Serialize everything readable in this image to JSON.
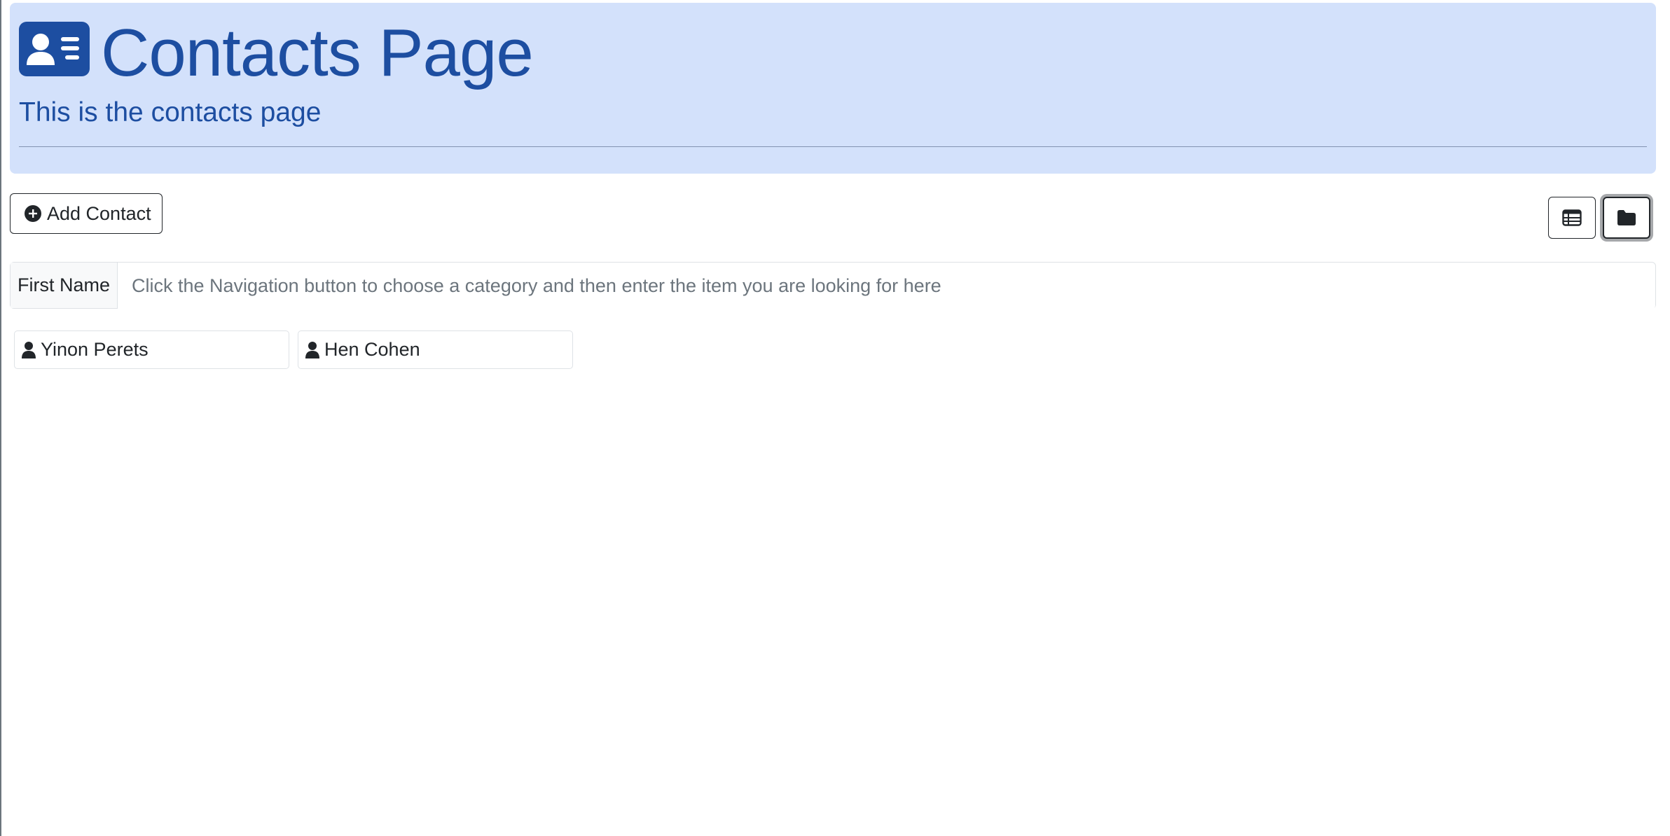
{
  "header": {
    "logo_icon": "person-vcard-icon",
    "title": "Contacts Page",
    "subtitle": "This is the contacts page",
    "background_color": "#d3e1fb",
    "accent_color": "#1d4ea1"
  },
  "toolbar": {
    "add_label": "Add Contact",
    "add_icon": "plus-circle-icon",
    "view_buttons": [
      {
        "icon": "table-icon",
        "active": false
      },
      {
        "icon": "folder-icon",
        "active": true
      }
    ]
  },
  "search": {
    "category_label": "First Name",
    "placeholder": "Click the Navigation button to choose a category and then enter the item you are looking for here",
    "value": ""
  },
  "contacts": [
    {
      "name": "Yinon Perets",
      "icon": "person-icon"
    },
    {
      "name": "Hen Cohen",
      "icon": "person-icon"
    }
  ]
}
